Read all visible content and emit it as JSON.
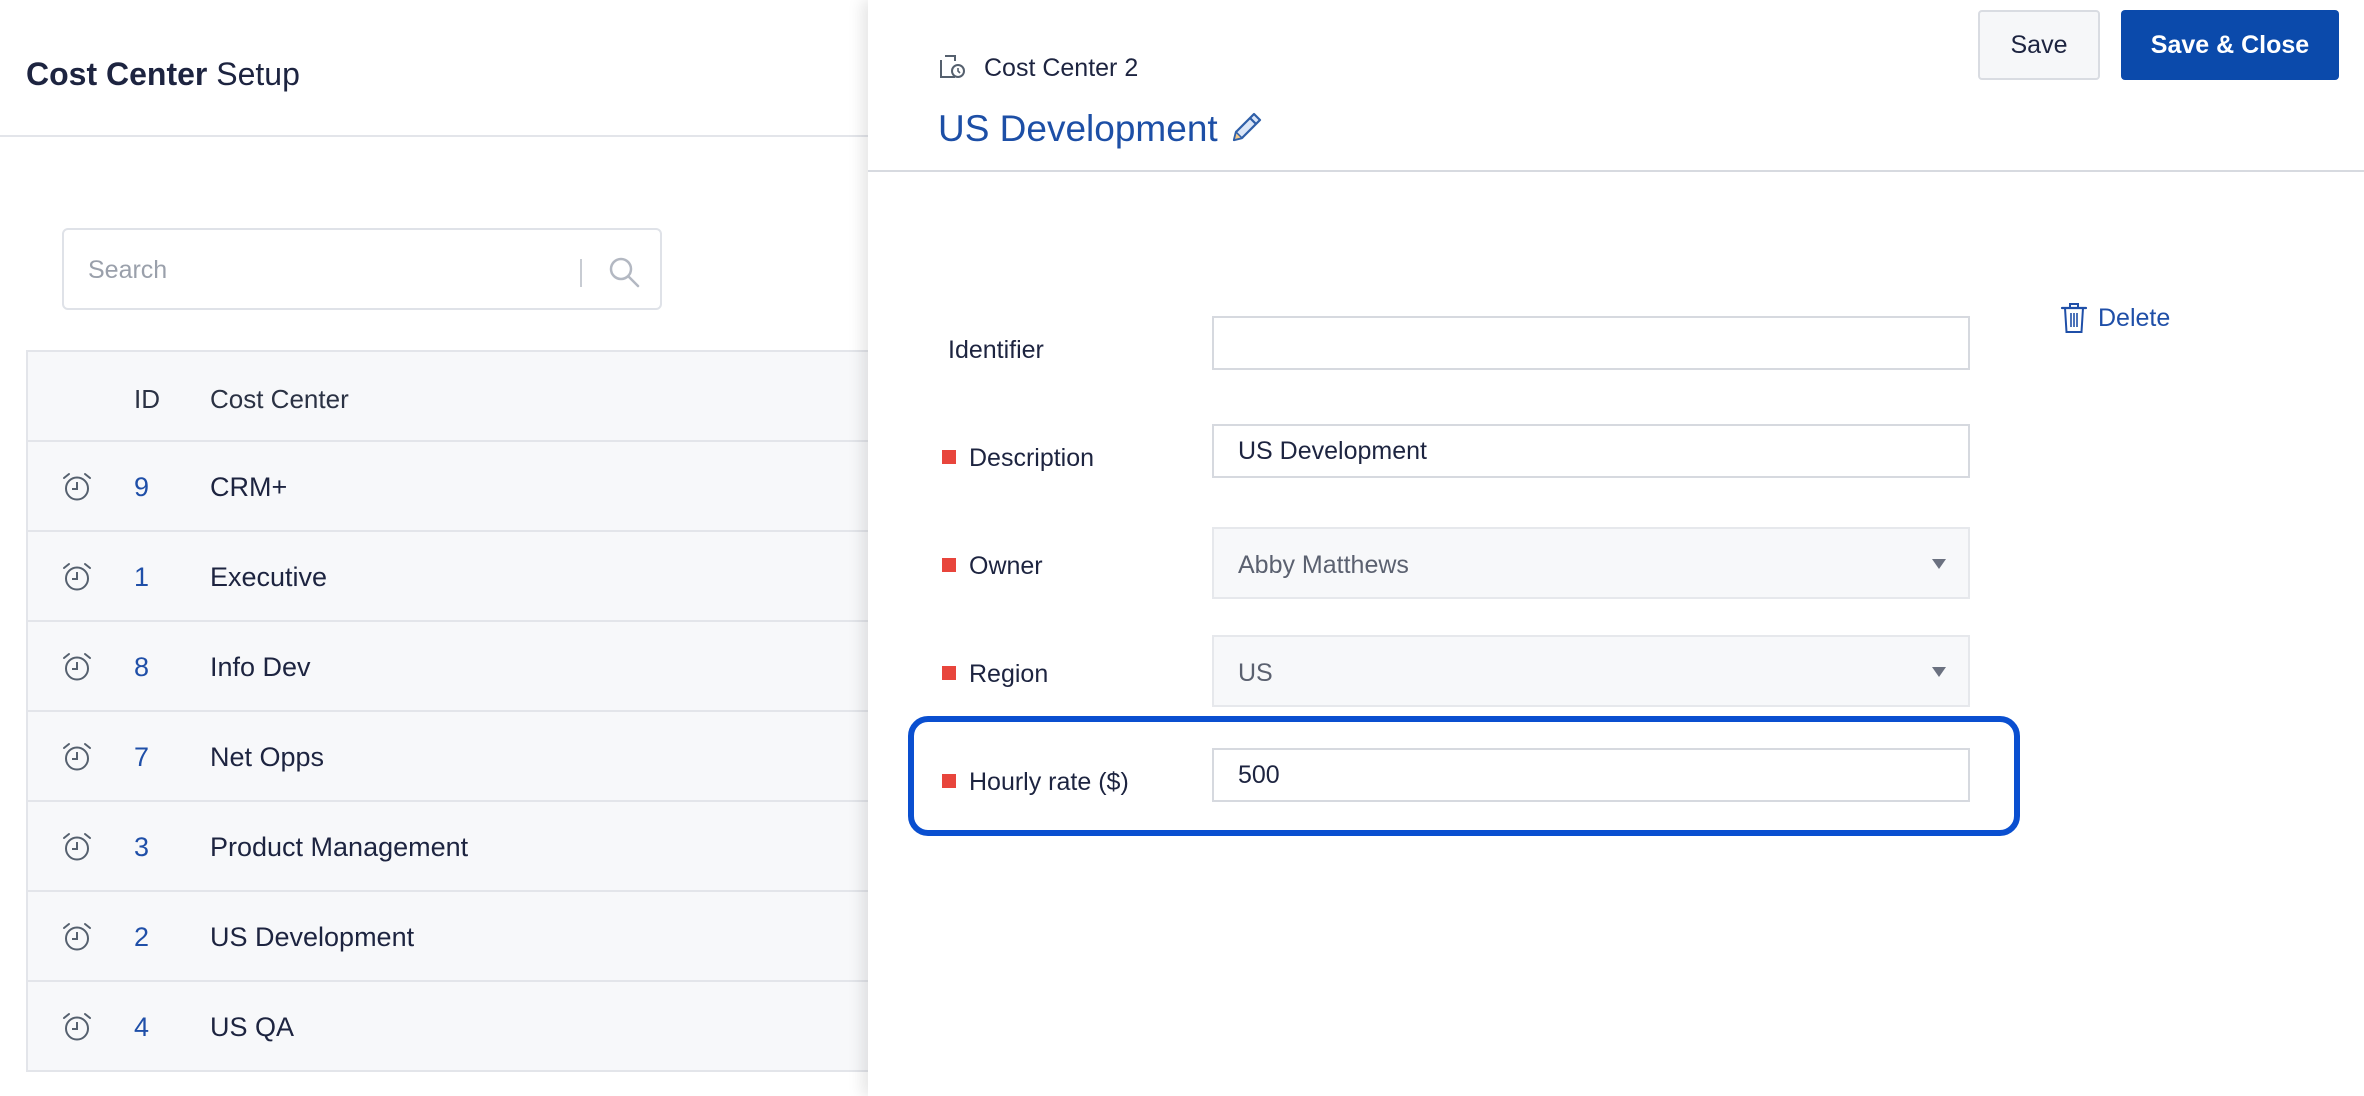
{
  "page": {
    "title_bold": "Cost Center",
    "title_rest": "Setup"
  },
  "search": {
    "placeholder": "Search",
    "value": ""
  },
  "list": {
    "headers": {
      "id": "ID",
      "name": "Cost Center"
    },
    "rows": [
      {
        "id": "9",
        "name": "CRM+"
      },
      {
        "id": "1",
        "name": "Executive"
      },
      {
        "id": "8",
        "name": "Info Dev"
      },
      {
        "id": "7",
        "name": "Net Opps"
      },
      {
        "id": "3",
        "name": "Product Management"
      },
      {
        "id": "2",
        "name": "US Development"
      },
      {
        "id": "4",
        "name": "US QA"
      }
    ]
  },
  "panel": {
    "crumb": "Cost Center 2",
    "title": "US Development",
    "save_label": "Save",
    "save_close_label": "Save & Close",
    "delete_label": "Delete"
  },
  "form": {
    "identifier": {
      "label": "Identifier",
      "value": ""
    },
    "description": {
      "label": "Description",
      "value": "US Development"
    },
    "owner": {
      "label": "Owner",
      "value": "Abby Matthews"
    },
    "region": {
      "label": "Region",
      "value": "US"
    },
    "hourly_rate": {
      "label": "Hourly rate ($)",
      "value": "500"
    }
  },
  "colors": {
    "accent": "#0b4aab",
    "link": "#1f4fa8",
    "required": "#e8453c",
    "highlight": "#0a4fd0"
  }
}
